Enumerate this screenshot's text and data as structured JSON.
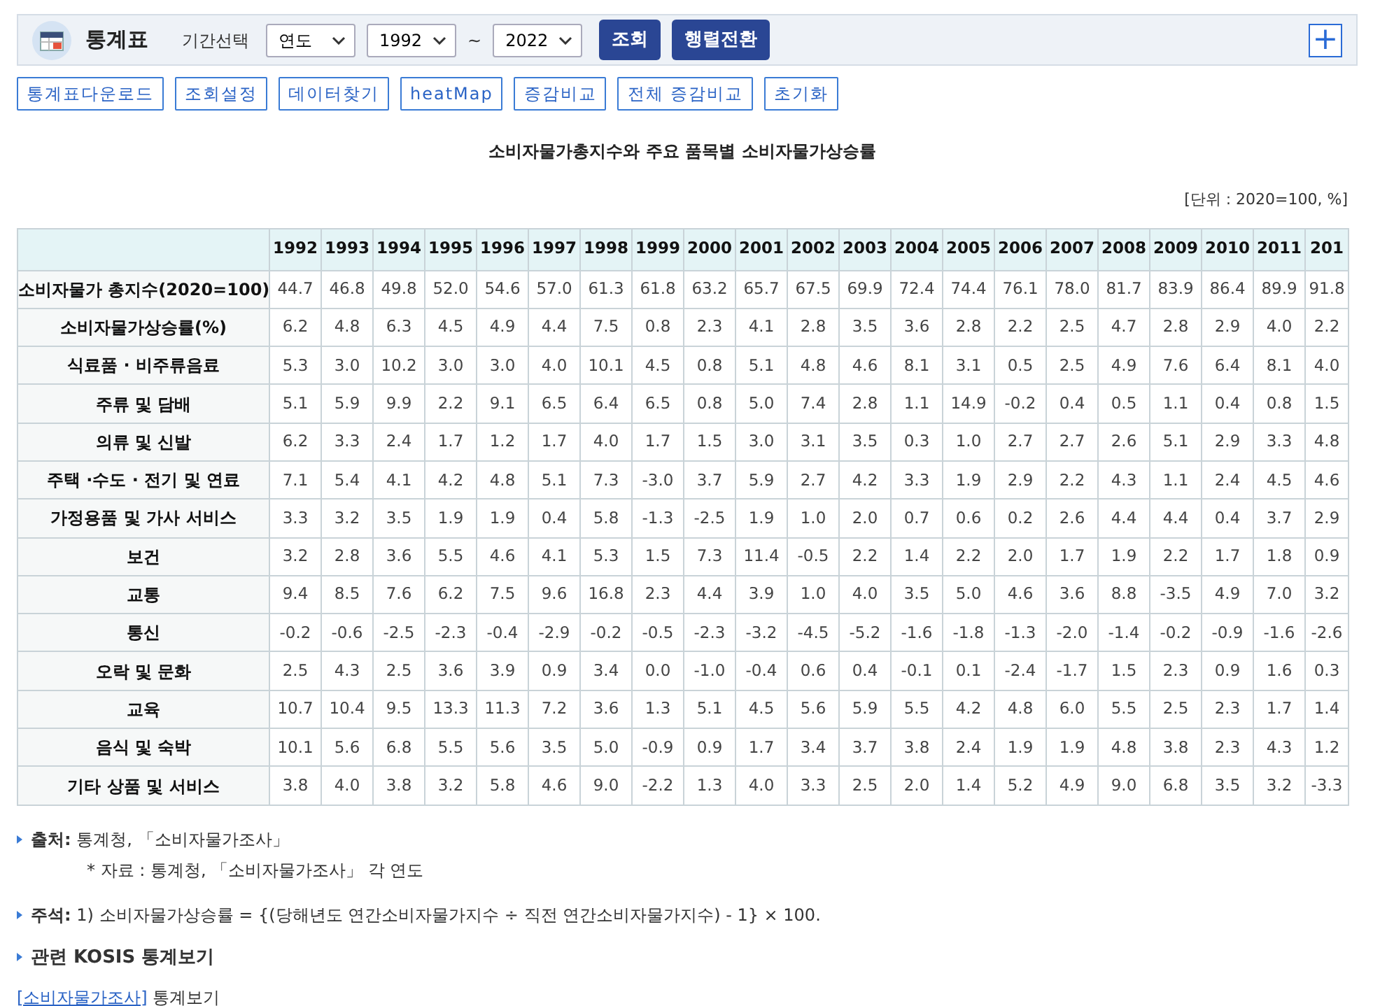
{
  "toolbar": {
    "title": "통계표",
    "period_label": "기간선택",
    "period_type": "연도",
    "start_year": "1992",
    "separator": "~",
    "end_year": "2022",
    "buttons": [
      "조회",
      "행렬전환"
    ],
    "expand": "+"
  },
  "actions": [
    "통계표다운로드",
    "조회설정",
    "데이터찾기",
    "heatMap",
    "증감비교",
    "전체 증감비교",
    "초기화"
  ],
  "table_title": "소비자물가총지수와 주요 품목별 소비자물가상승률",
  "unit": "[단위 : 2020=100, %]",
  "table": {
    "columns": [
      "1992",
      "1993",
      "1994",
      "1995",
      "1996",
      "1997",
      "1998",
      "1999",
      "2000",
      "2001",
      "2002",
      "2003",
      "2004",
      "2005",
      "2006",
      "2007",
      "2008",
      "2009",
      "2010",
      "2011",
      "201"
    ],
    "rows": [
      {
        "label": "소비자물가 총지수(2020=100)",
        "values": [
          "44.7",
          "46.8",
          "49.8",
          "52.0",
          "54.6",
          "57.0",
          "61.3",
          "61.8",
          "63.2",
          "65.7",
          "67.5",
          "69.9",
          "72.4",
          "74.4",
          "76.1",
          "78.0",
          "81.7",
          "83.9",
          "86.4",
          "89.9",
          "91.8"
        ]
      },
      {
        "label": "소비자물가상승률(%)",
        "values": [
          "6.2",
          "4.8",
          "6.3",
          "4.5",
          "4.9",
          "4.4",
          "7.5",
          "0.8",
          "2.3",
          "4.1",
          "2.8",
          "3.5",
          "3.6",
          "2.8",
          "2.2",
          "2.5",
          "4.7",
          "2.8",
          "2.9",
          "4.0",
          "2.2"
        ]
      },
      {
        "label": "식료품 · 비주류음료",
        "values": [
          "5.3",
          "3.0",
          "10.2",
          "3.0",
          "3.0",
          "4.0",
          "10.1",
          "4.5",
          "0.8",
          "5.1",
          "4.8",
          "4.6",
          "8.1",
          "3.1",
          "0.5",
          "2.5",
          "4.9",
          "7.6",
          "6.4",
          "8.1",
          "4.0"
        ]
      },
      {
        "label": "주류 및 담배",
        "values": [
          "5.1",
          "5.9",
          "9.9",
          "2.2",
          "9.1",
          "6.5",
          "6.4",
          "6.5",
          "0.8",
          "5.0",
          "7.4",
          "2.8",
          "1.1",
          "14.9",
          "-0.2",
          "0.4",
          "0.5",
          "1.1",
          "0.4",
          "0.8",
          "1.5"
        ]
      },
      {
        "label": "의류 및 신발",
        "values": [
          "6.2",
          "3.3",
          "2.4",
          "1.7",
          "1.2",
          "1.7",
          "4.0",
          "1.7",
          "1.5",
          "3.0",
          "3.1",
          "3.5",
          "0.3",
          "1.0",
          "2.7",
          "2.7",
          "2.6",
          "5.1",
          "2.9",
          "3.3",
          "4.8"
        ]
      },
      {
        "label": "주택 ·수도 · 전기 및 연료",
        "values": [
          "7.1",
          "5.4",
          "4.1",
          "4.2",
          "4.8",
          "5.1",
          "7.3",
          "-3.0",
          "3.7",
          "5.9",
          "2.7",
          "4.2",
          "3.3",
          "1.9",
          "2.9",
          "2.2",
          "4.3",
          "1.1",
          "2.4",
          "4.5",
          "4.6"
        ]
      },
      {
        "label": "가정용품 및 가사 서비스",
        "values": [
          "3.3",
          "3.2",
          "3.5",
          "1.9",
          "1.9",
          "0.4",
          "5.8",
          "-1.3",
          "-2.5",
          "1.9",
          "1.0",
          "2.0",
          "0.7",
          "0.6",
          "0.2",
          "2.6",
          "4.4",
          "4.4",
          "0.4",
          "3.7",
          "2.9"
        ]
      },
      {
        "label": "보건",
        "values": [
          "3.2",
          "2.8",
          "3.6",
          "5.5",
          "4.6",
          "4.1",
          "5.3",
          "1.5",
          "7.3",
          "11.4",
          "-0.5",
          "2.2",
          "1.4",
          "2.2",
          "2.0",
          "1.7",
          "1.9",
          "2.2",
          "1.7",
          "1.8",
          "0.9"
        ]
      },
      {
        "label": "교통",
        "values": [
          "9.4",
          "8.5",
          "7.6",
          "6.2",
          "7.5",
          "9.6",
          "16.8",
          "2.3",
          "4.4",
          "3.9",
          "1.0",
          "4.0",
          "3.5",
          "5.0",
          "4.6",
          "3.6",
          "8.8",
          "-3.5",
          "4.9",
          "7.0",
          "3.2"
        ]
      },
      {
        "label": "통신",
        "values": [
          "-0.2",
          "-0.6",
          "-2.5",
          "-2.3",
          "-0.4",
          "-2.9",
          "-0.2",
          "-0.5",
          "-2.3",
          "-3.2",
          "-4.5",
          "-5.2",
          "-1.6",
          "-1.8",
          "-1.3",
          "-2.0",
          "-1.4",
          "-0.2",
          "-0.9",
          "-1.6",
          "-2.6"
        ]
      },
      {
        "label": "오락 및 문화",
        "values": [
          "2.5",
          "4.3",
          "2.5",
          "3.6",
          "3.9",
          "0.9",
          "3.4",
          "0.0",
          "-1.0",
          "-0.4",
          "0.6",
          "0.4",
          "-0.1",
          "0.1",
          "-2.4",
          "-1.7",
          "1.5",
          "2.3",
          "0.9",
          "1.6",
          "0.3"
        ]
      },
      {
        "label": "교육",
        "values": [
          "10.7",
          "10.4",
          "9.5",
          "13.3",
          "11.3",
          "7.2",
          "3.6",
          "1.3",
          "5.1",
          "4.5",
          "5.6",
          "5.9",
          "5.5",
          "4.2",
          "4.8",
          "6.0",
          "5.5",
          "2.5",
          "2.3",
          "1.7",
          "1.4"
        ]
      },
      {
        "label": "음식 및 숙박",
        "values": [
          "10.1",
          "5.6",
          "6.8",
          "5.5",
          "5.6",
          "3.5",
          "5.0",
          "-0.9",
          "0.9",
          "1.7",
          "3.4",
          "3.7",
          "3.8",
          "2.4",
          "1.9",
          "1.9",
          "4.8",
          "3.8",
          "2.3",
          "4.3",
          "1.2"
        ]
      },
      {
        "label": "기타 상품 및 서비스",
        "values": [
          "3.8",
          "4.0",
          "3.8",
          "3.2",
          "5.8",
          "4.6",
          "9.0",
          "-2.2",
          "1.3",
          "4.0",
          "3.3",
          "2.5",
          "2.0",
          "1.4",
          "5.2",
          "4.9",
          "9.0",
          "6.8",
          "3.5",
          "3.2",
          "-3.3"
        ]
      }
    ]
  },
  "notes": {
    "source": "**출처:** 통계청, 「소비자물가조사」",
    "source_detail": "* 자료 : 통계청, 「소비자물가조사」 각 연도",
    "footnote": "**주석:** 1) 소비자물가상승률 = {(당해년도 연간소비자물가지수 ÷ 직전 연간소비자물가지수) - 1} × 100.",
    "related_heading": "관련 KOSIS 통계보기",
    "related_link": "[소비자물가조사]",
    "related_suffix": "통계보기"
  }
}
